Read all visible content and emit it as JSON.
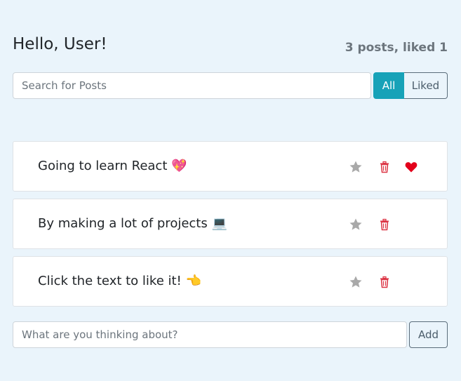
{
  "header": {
    "title": "Hello, User!",
    "stats": "3 posts, liked 1"
  },
  "search": {
    "placeholder": "Search for Posts",
    "value": ""
  },
  "filters": {
    "all_label": "All",
    "liked_label": "Liked",
    "active": "All"
  },
  "posts": [
    {
      "text": "Going to learn React 💖",
      "liked": true
    },
    {
      "text": "By making a lot of projects 💻",
      "liked": false
    },
    {
      "text": "Click the text to like it! 👈",
      "liked": false
    }
  ],
  "new_post": {
    "placeholder": "What are you thinking about?",
    "value": "",
    "add_label": "Add"
  },
  "colors": {
    "background": "#eaf4fb",
    "accent": "#17a2b8",
    "danger": "#dc3545",
    "heart": "#e3001b",
    "star": "#a9a9a9"
  }
}
